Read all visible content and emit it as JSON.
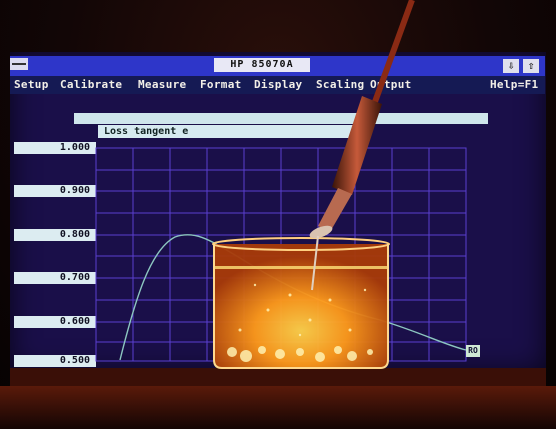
{
  "window": {
    "title": "HP 85070A",
    "restore_icon": "restore-icon",
    "maximize_icon": "maximize-icon",
    "restore_glyph": "⇩",
    "maximize_glyph": "⇧"
  },
  "menu": {
    "setup": "Setup",
    "calibrate": "Calibrate",
    "measure": "Measure",
    "format": "Format",
    "display": "Display",
    "scaling": "Scaling",
    "output": "Output",
    "help": "Help=F1"
  },
  "plot": {
    "title": "Loss tangent e",
    "y_ticks": [
      "1.000",
      "0.900",
      "0.800",
      "0.700",
      "0.600",
      "0.500"
    ],
    "marker_label": "RO"
  },
  "colors": {
    "screen": "#1a0f49",
    "title_bar": "#2e36c9",
    "grid": "#5a3fd0",
    "trace": "#8cc6c0",
    "liquid_glow": "#ff9a1a"
  }
}
